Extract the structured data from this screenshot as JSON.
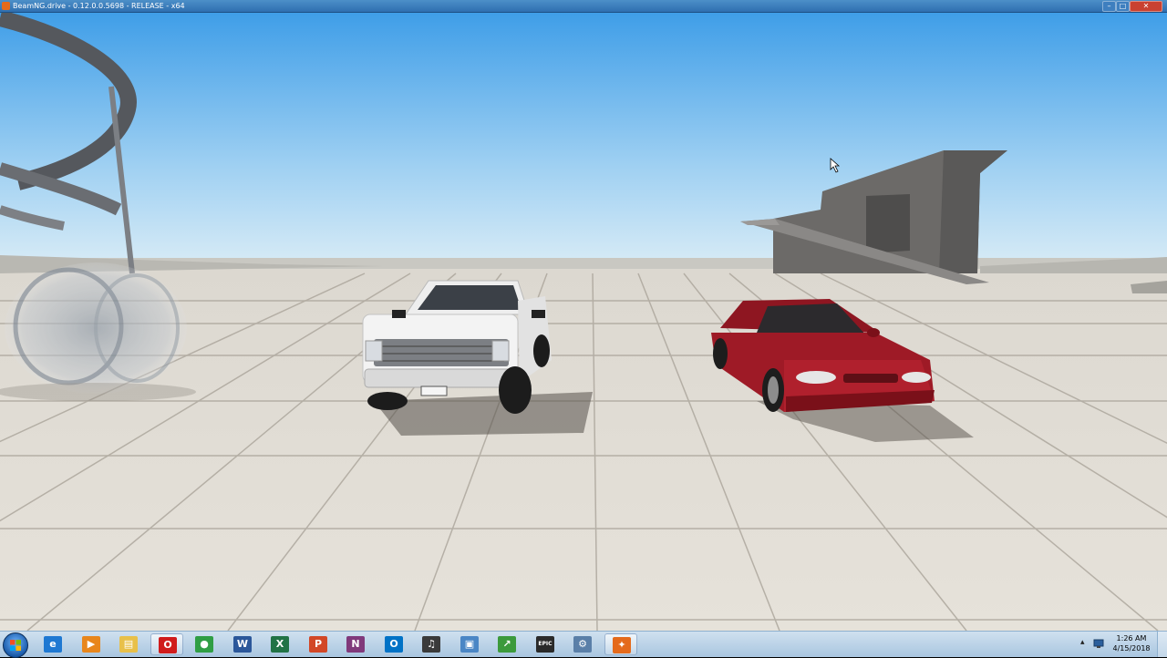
{
  "window": {
    "title": "BeamNG.drive - 0.12.0.0.5698 - RELEASE - x64",
    "controls": {
      "minimize": "–",
      "maximize": "□",
      "close": "✕"
    }
  },
  "scene": {
    "vehicles": [
      "white pickup truck",
      "red sedan"
    ]
  },
  "taskbar": {
    "start_icon": "windows-start-orb-icon",
    "pinned_apps": [
      {
        "name": "internet-explorer",
        "glyph": "e",
        "color": "#1e78d2"
      },
      {
        "name": "media-player",
        "glyph": "▶",
        "color": "#e8861c"
      },
      {
        "name": "file-explorer",
        "glyph": "▤",
        "color": "#e8c04a"
      },
      {
        "name": "opera",
        "glyph": "O",
        "color": "#d01c1c"
      },
      {
        "name": "chrome",
        "glyph": "●",
        "color": "#2f9e44"
      },
      {
        "name": "word",
        "glyph": "W",
        "color": "#2b579a"
      },
      {
        "name": "excel",
        "glyph": "X",
        "color": "#217346"
      },
      {
        "name": "powerpoint",
        "glyph": "P",
        "color": "#d24726"
      },
      {
        "name": "onenote",
        "glyph": "N",
        "color": "#80397b"
      },
      {
        "name": "outlook",
        "glyph": "O",
        "color": "#0072c6"
      },
      {
        "name": "audio-app",
        "glyph": "♫",
        "color": "#3a3a3a"
      },
      {
        "name": "remote-desktop",
        "glyph": "▣",
        "color": "#4a86c5"
      },
      {
        "name": "chart-app",
        "glyph": "↗",
        "color": "#3c9a3c"
      },
      {
        "name": "epic-games-launcher",
        "glyph": "EPIC",
        "color": "#2a2a2a"
      },
      {
        "name": "system-tool",
        "glyph": "⚙",
        "color": "#5a7fa8"
      },
      {
        "name": "beamng-drive",
        "glyph": "✦",
        "color": "#e46a1c"
      }
    ],
    "tray": {
      "overflow": "▴",
      "time": "1:26 AM",
      "date": "4/15/2018"
    }
  }
}
